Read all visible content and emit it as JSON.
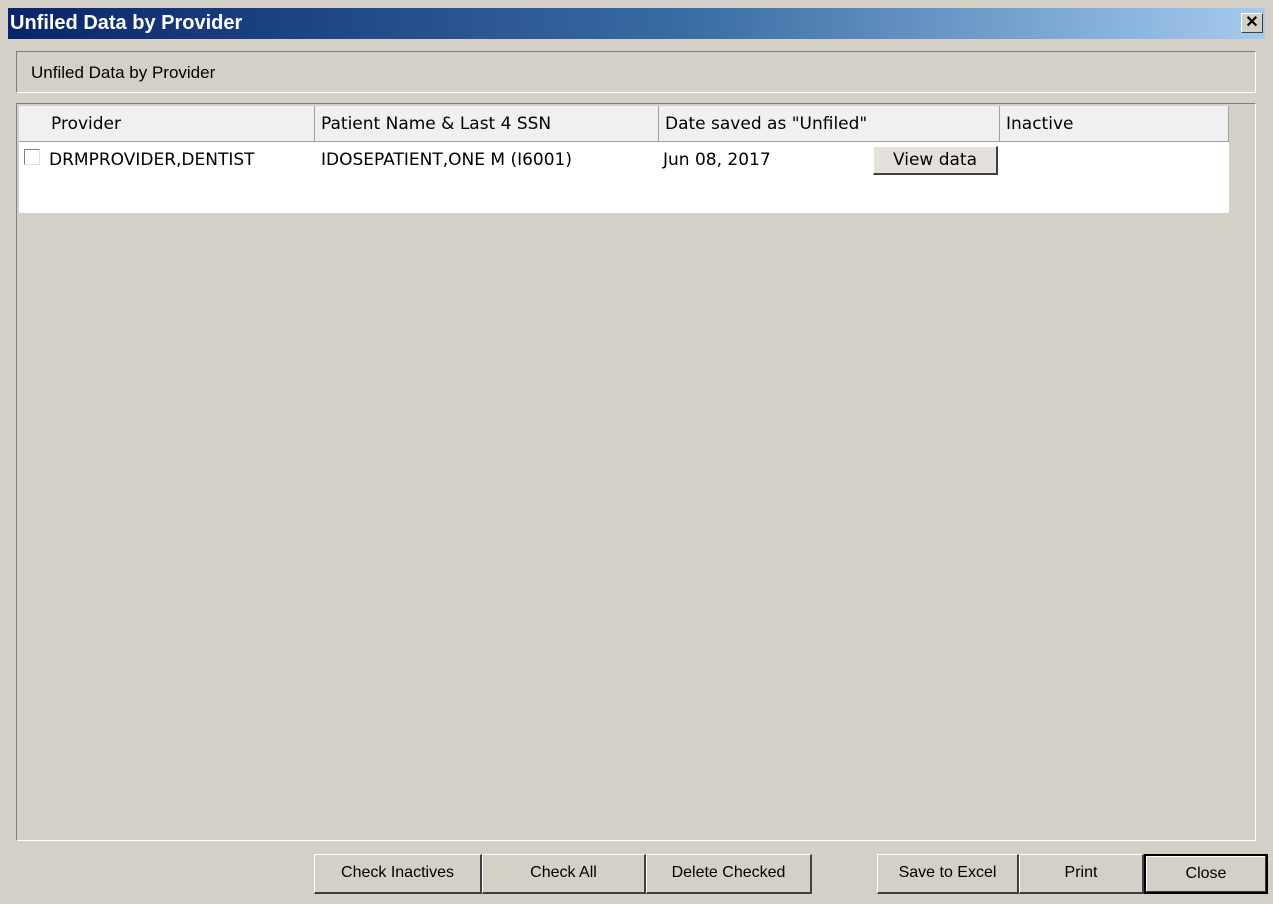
{
  "window": {
    "title": "Unfiled Data by Provider",
    "close_glyph": "✕"
  },
  "header_panel": {
    "label": "Unfiled Data by Provider"
  },
  "grid": {
    "columns": [
      "Provider",
      "Patient Name & Last 4 SSN",
      "Date saved as \"Unfiled\"",
      "Inactive"
    ],
    "rows": [
      {
        "checked": false,
        "provider": "DRMPROVIDER,DENTIST",
        "patient": "IDOSEPATIENT,ONE M (I6001)",
        "date_saved": "Jun 08, 2017",
        "action_label": "View data",
        "inactive": ""
      }
    ]
  },
  "buttons": {
    "check_inactives": "Check Inactives",
    "check_all": "Check All",
    "delete_checked": "Delete Checked",
    "save_to_excel": "Save to Excel",
    "print": "Print",
    "close": "Close"
  },
  "colors": {
    "titlebar_start": "#0a246a",
    "titlebar_end": "#a6caf0",
    "face": "#d4d0c8"
  }
}
